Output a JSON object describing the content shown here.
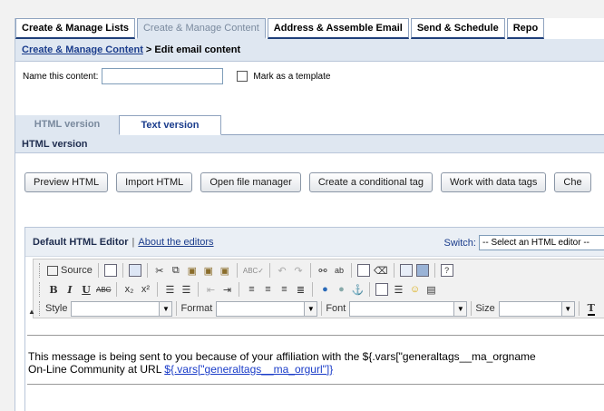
{
  "main_tabs": [
    "Create & Manage Lists",
    "Create & Manage Content",
    "Address & Assemble Email",
    "Send & Schedule",
    "Repo"
  ],
  "breadcrumb": {
    "link": "Create & Manage Content",
    "separator": ">",
    "current": "Edit email content"
  },
  "name_row": {
    "label": "Name this content:",
    "value": "",
    "template_label": "Mark as a template"
  },
  "version_tabs": [
    "HTML version",
    "Text version"
  ],
  "section_title": "HTML version",
  "buttons": [
    "Preview HTML",
    "Import HTML",
    "Open file manager",
    "Create a conditional tag",
    "Work with data tags",
    "Che"
  ],
  "editor": {
    "title": "Default HTML Editor",
    "separator": "|",
    "about_link": "About the editors",
    "switch_label": "Switch:",
    "switch_value": "-- Select an HTML editor --"
  },
  "toolbar": {
    "source_label": "Source",
    "bold": "B",
    "italic": "I",
    "underline": "U",
    "strike": "ABC",
    "sub": "x₂",
    "sup": "x²",
    "style_label": "Style",
    "format_label": "Format",
    "font_label": "Font",
    "size_label": "Size"
  },
  "content": {
    "line1": "This message is being sent to you because of your affiliation with the ${.vars[\"generaltags__ma_orgname",
    "line2_prefix": "On-Line Community at URL ",
    "line2_link": "${.vars[\"generaltags__ma_orgurl\"]}"
  }
}
